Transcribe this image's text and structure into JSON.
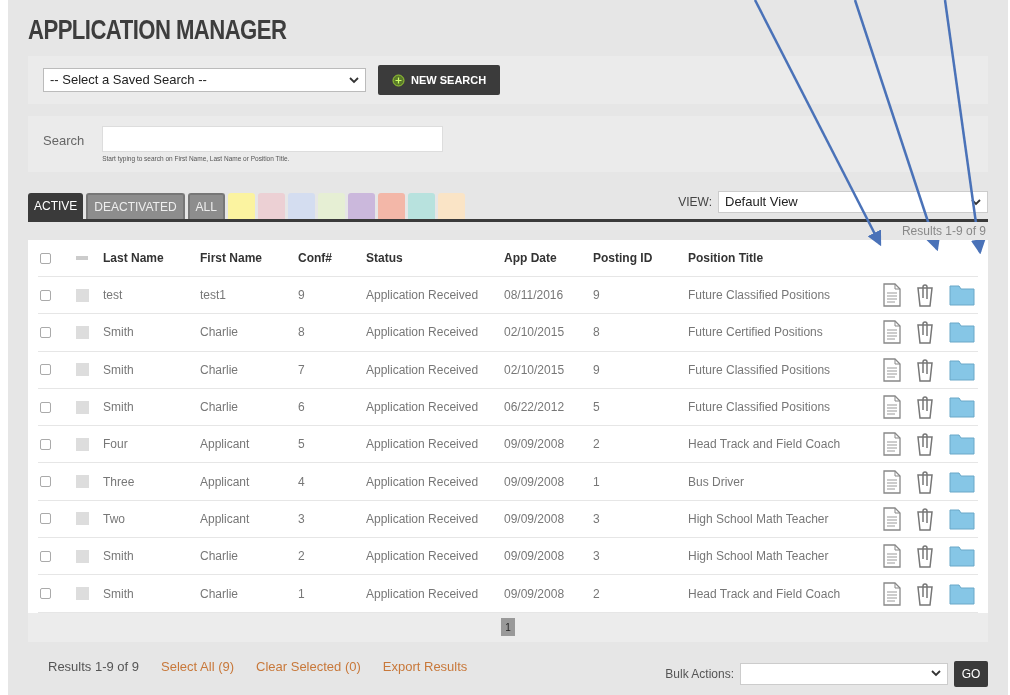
{
  "title": "APPLICATION MANAGER",
  "saved_search": {
    "value": "-- Select a Saved Search --"
  },
  "new_search_button": {
    "label": "NEW SEARCH"
  },
  "search": {
    "label": "Search",
    "hint": "Start typing to search on First Name, Last Name or Position Title."
  },
  "tabs": [
    {
      "label": "ACTIVE",
      "selected": true
    },
    {
      "label": "DEACTIVATED",
      "selected": false
    },
    {
      "label": "ALL",
      "selected": false
    }
  ],
  "color_tabs": [
    {
      "color": "#fbf3a0"
    },
    {
      "color": "#ecd0d4"
    },
    {
      "color": "#d4ddf0"
    },
    {
      "color": "#e6efd4"
    },
    {
      "color": "#cbb8dc"
    },
    {
      "color": "#f3b7a8"
    },
    {
      "color": "#b8e2de"
    },
    {
      "color": "#fae4c6"
    }
  ],
  "view": {
    "label": "VIEW:",
    "value": "Default View"
  },
  "results_top": "Results 1-9 of 9",
  "table": {
    "select_all_checked": false,
    "columns": [
      "Last Name",
      "First Name",
      "Conf#",
      "Status",
      "App Date",
      "Posting ID",
      "Position Title"
    ],
    "rows": [
      {
        "cells": [
          "test",
          "test1",
          "9",
          "Application Received",
          "08/11/2016",
          "9",
          "Future Classified Positions"
        ],
        "checked": false
      },
      {
        "cells": [
          "Smith",
          "Charlie",
          "8",
          "Application Received",
          "02/10/2015",
          "8",
          "Future Certified Positions"
        ],
        "checked": false
      },
      {
        "cells": [
          "Smith",
          "Charlie",
          "7",
          "Application Received",
          "02/10/2015",
          "9",
          "Future Classified Positions"
        ],
        "checked": false
      },
      {
        "cells": [
          "Smith",
          "Charlie",
          "6",
          "Application Received",
          "06/22/2012",
          "5",
          "Future Classified Positions"
        ],
        "checked": false
      },
      {
        "cells": [
          "Four",
          "Applicant",
          "5",
          "Application Received",
          "09/09/2008",
          "2",
          "Head Track and Field Coach"
        ],
        "checked": false
      },
      {
        "cells": [
          "Three",
          "Applicant",
          "4",
          "Application Received",
          "09/09/2008",
          "1",
          "Bus Driver"
        ],
        "checked": false
      },
      {
        "cells": [
          "Two",
          "Applicant",
          "3",
          "Application Received",
          "09/09/2008",
          "3",
          "High School Math Teacher"
        ],
        "checked": false
      },
      {
        "cells": [
          "Smith",
          "Charlie",
          "2",
          "Application Received",
          "09/09/2008",
          "3",
          "High School Math Teacher"
        ],
        "checked": false
      },
      {
        "cells": [
          "Smith",
          "Charlie",
          "1",
          "Application Received",
          "09/09/2008",
          "2",
          "Head Track and Field Coach"
        ],
        "checked": false
      }
    ]
  },
  "pagination": [
    {
      "label": "1",
      "selected": true
    }
  ],
  "footer": {
    "results": "Results 1-9 of 9",
    "links": [
      "Select All (9)",
      "Clear Selected (0)",
      "Export Results"
    ],
    "bulk_label": "Bulk Actions:",
    "go": "GO"
  }
}
